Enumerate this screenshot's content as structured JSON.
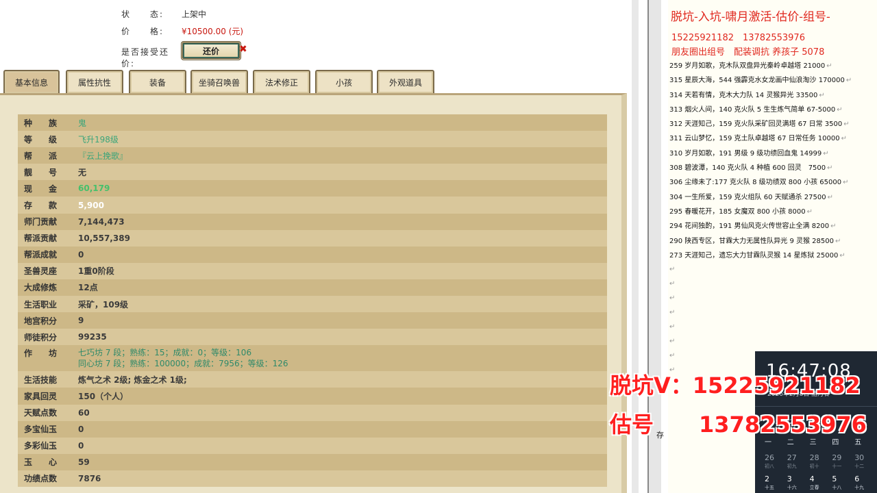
{
  "listing": {
    "status_label": "状　　态:",
    "status_value": "上架中",
    "price_label": "价　　格:",
    "price_value": "¥10500.00 (元)",
    "offer_label": "是否接受还价:",
    "offer_button": "还价",
    "offer_mark": "✖"
  },
  "tabs": [
    "基本信息",
    "属性抗性",
    "装备",
    "坐骑召唤兽",
    "法术修正",
    "小孩",
    "外观道具"
  ],
  "active_tab": 0,
  "rows": [
    {
      "k": "种族",
      "v": "鬼",
      "style": "green",
      "spaced": true
    },
    {
      "k": "等级",
      "v": "飞升198级",
      "style": "green",
      "spaced": true
    },
    {
      "k": "帮派",
      "v": "『云上挽歌』",
      "style": "green",
      "spaced": true
    },
    {
      "k": "靓号",
      "v": "无",
      "style": "normal",
      "spaced": true
    },
    {
      "k": "现金",
      "v": "60,179",
      "style": "bright",
      "spaced": true
    },
    {
      "k": "存款",
      "v": "5,900",
      "style": "white",
      "spaced": true
    },
    {
      "k": "师门贡献",
      "v": "7,144,473",
      "style": "normal"
    },
    {
      "k": "帮派贡献",
      "v": "10,557,389",
      "style": "normal"
    },
    {
      "k": "帮派成就",
      "v": "0",
      "style": "normal"
    },
    {
      "k": "圣兽灵座",
      "v": "1重0阶段",
      "style": "normal"
    },
    {
      "k": "大成修炼",
      "v": "12点",
      "style": "normal"
    },
    {
      "k": "生活职业",
      "v": "采矿，109级",
      "style": "normal"
    },
    {
      "k": "地宫积分",
      "v": "9",
      "style": "normal"
    },
    {
      "k": "师徒积分",
      "v": "99235",
      "style": "normal"
    }
  ],
  "workshop": {
    "k": "作坊",
    "line1": "七巧坊 7 段；熟练：15；成就：0；等级：106",
    "line2": "同心坊 7 段；熟练：100000；成就：7956；等级：126"
  },
  "rows2": [
    {
      "k": "生活技能",
      "v": "炼气之术 2级; 炼金之术 1级;",
      "style": "normal"
    },
    {
      "k": "家具回灵",
      "v": "150（个人）",
      "style": "normal"
    },
    {
      "k": "天赋点数",
      "v": "60",
      "style": "normal"
    },
    {
      "k": "多宝仙玉",
      "v": "0",
      "style": "normal"
    },
    {
      "k": "多彩仙玉",
      "v": "0",
      "style": "normal"
    },
    {
      "k": "玉心",
      "v": "59",
      "style": "normal",
      "spaced": true
    },
    {
      "k": "功绩点数",
      "v": "7876",
      "style": "normal"
    }
  ],
  "doc": {
    "title": "脱坑-入坑-啸月激活-估价-组号-",
    "phones": "15225921182　13782553976",
    "tagline": "朋友圈出组号　配装调抗 养孩子 5078",
    "lines": [
      "259 岁月如歌，克木队双盘异光秦岭卓越塔 21000",
      "315 星辰大海，544 强霹克水女龙画中仙浪淘沙 170000",
      "314 天若有情，克木大力队 14 灵猴异光 33500",
      "313 烟火人间，140 克火队 5 生生炼气简单 67-5000",
      "312 天涯知己，159 克火队采矿回灵满塔 67 日常 3500",
      "311 云山梦忆，159 克土队卓越塔 67 日常任务 10000",
      "310 岁月如歌，191 男级 9 级功绩回血鬼 14999",
      "308 碧波潭，140 克火队 4 种植 600 回灵　7500",
      "306 尘缘未了:177 克火队 8 级功绩双 800 小孩 65000",
      "304 一生所爱，159 克火组队 60 天赋通杀 27500",
      "295 春暖花开，185 女魔双 800 小孩 8000",
      "294 花间独酌，191 男仙风克火传世容止全满 8200",
      "290 陕西专区，甘霖大力无属性队异光 9 灵猴 28500",
      "273 天涯知己，遗忘大力甘霖队灵猴 14 星炼狱 25000"
    ],
    "return_mark": "↵"
  },
  "clock": {
    "time": "16:47:08",
    "date": "2026年2月8日 腊月廿一",
    "month": "2026年2月",
    "weekdays": [
      "一",
      "二",
      "三",
      "四",
      "五"
    ],
    "week1": [
      [
        "26",
        "初八"
      ],
      [
        "27",
        "初九"
      ],
      [
        "28",
        "初十"
      ],
      [
        "29",
        "十一"
      ],
      [
        "30",
        "十二"
      ]
    ],
    "week2": [
      [
        "2",
        "十五"
      ],
      [
        "3",
        "十六"
      ],
      [
        "4",
        "立春"
      ],
      [
        "5",
        "十八"
      ],
      [
        "6",
        "十九"
      ]
    ]
  },
  "overlay": {
    "line1_label": "脱坑V：",
    "line1_num": "15225921182",
    "line2_label": "估号",
    "line2_num": "13782553976"
  },
  "partial_char": "存",
  "colors": {
    "accent_red": "#e0281f",
    "overlay_red": "#ff1f1f",
    "panel_bg": "#ece4c9",
    "row_odd": "#cdb887",
    "row_even": "#d9c79b"
  }
}
